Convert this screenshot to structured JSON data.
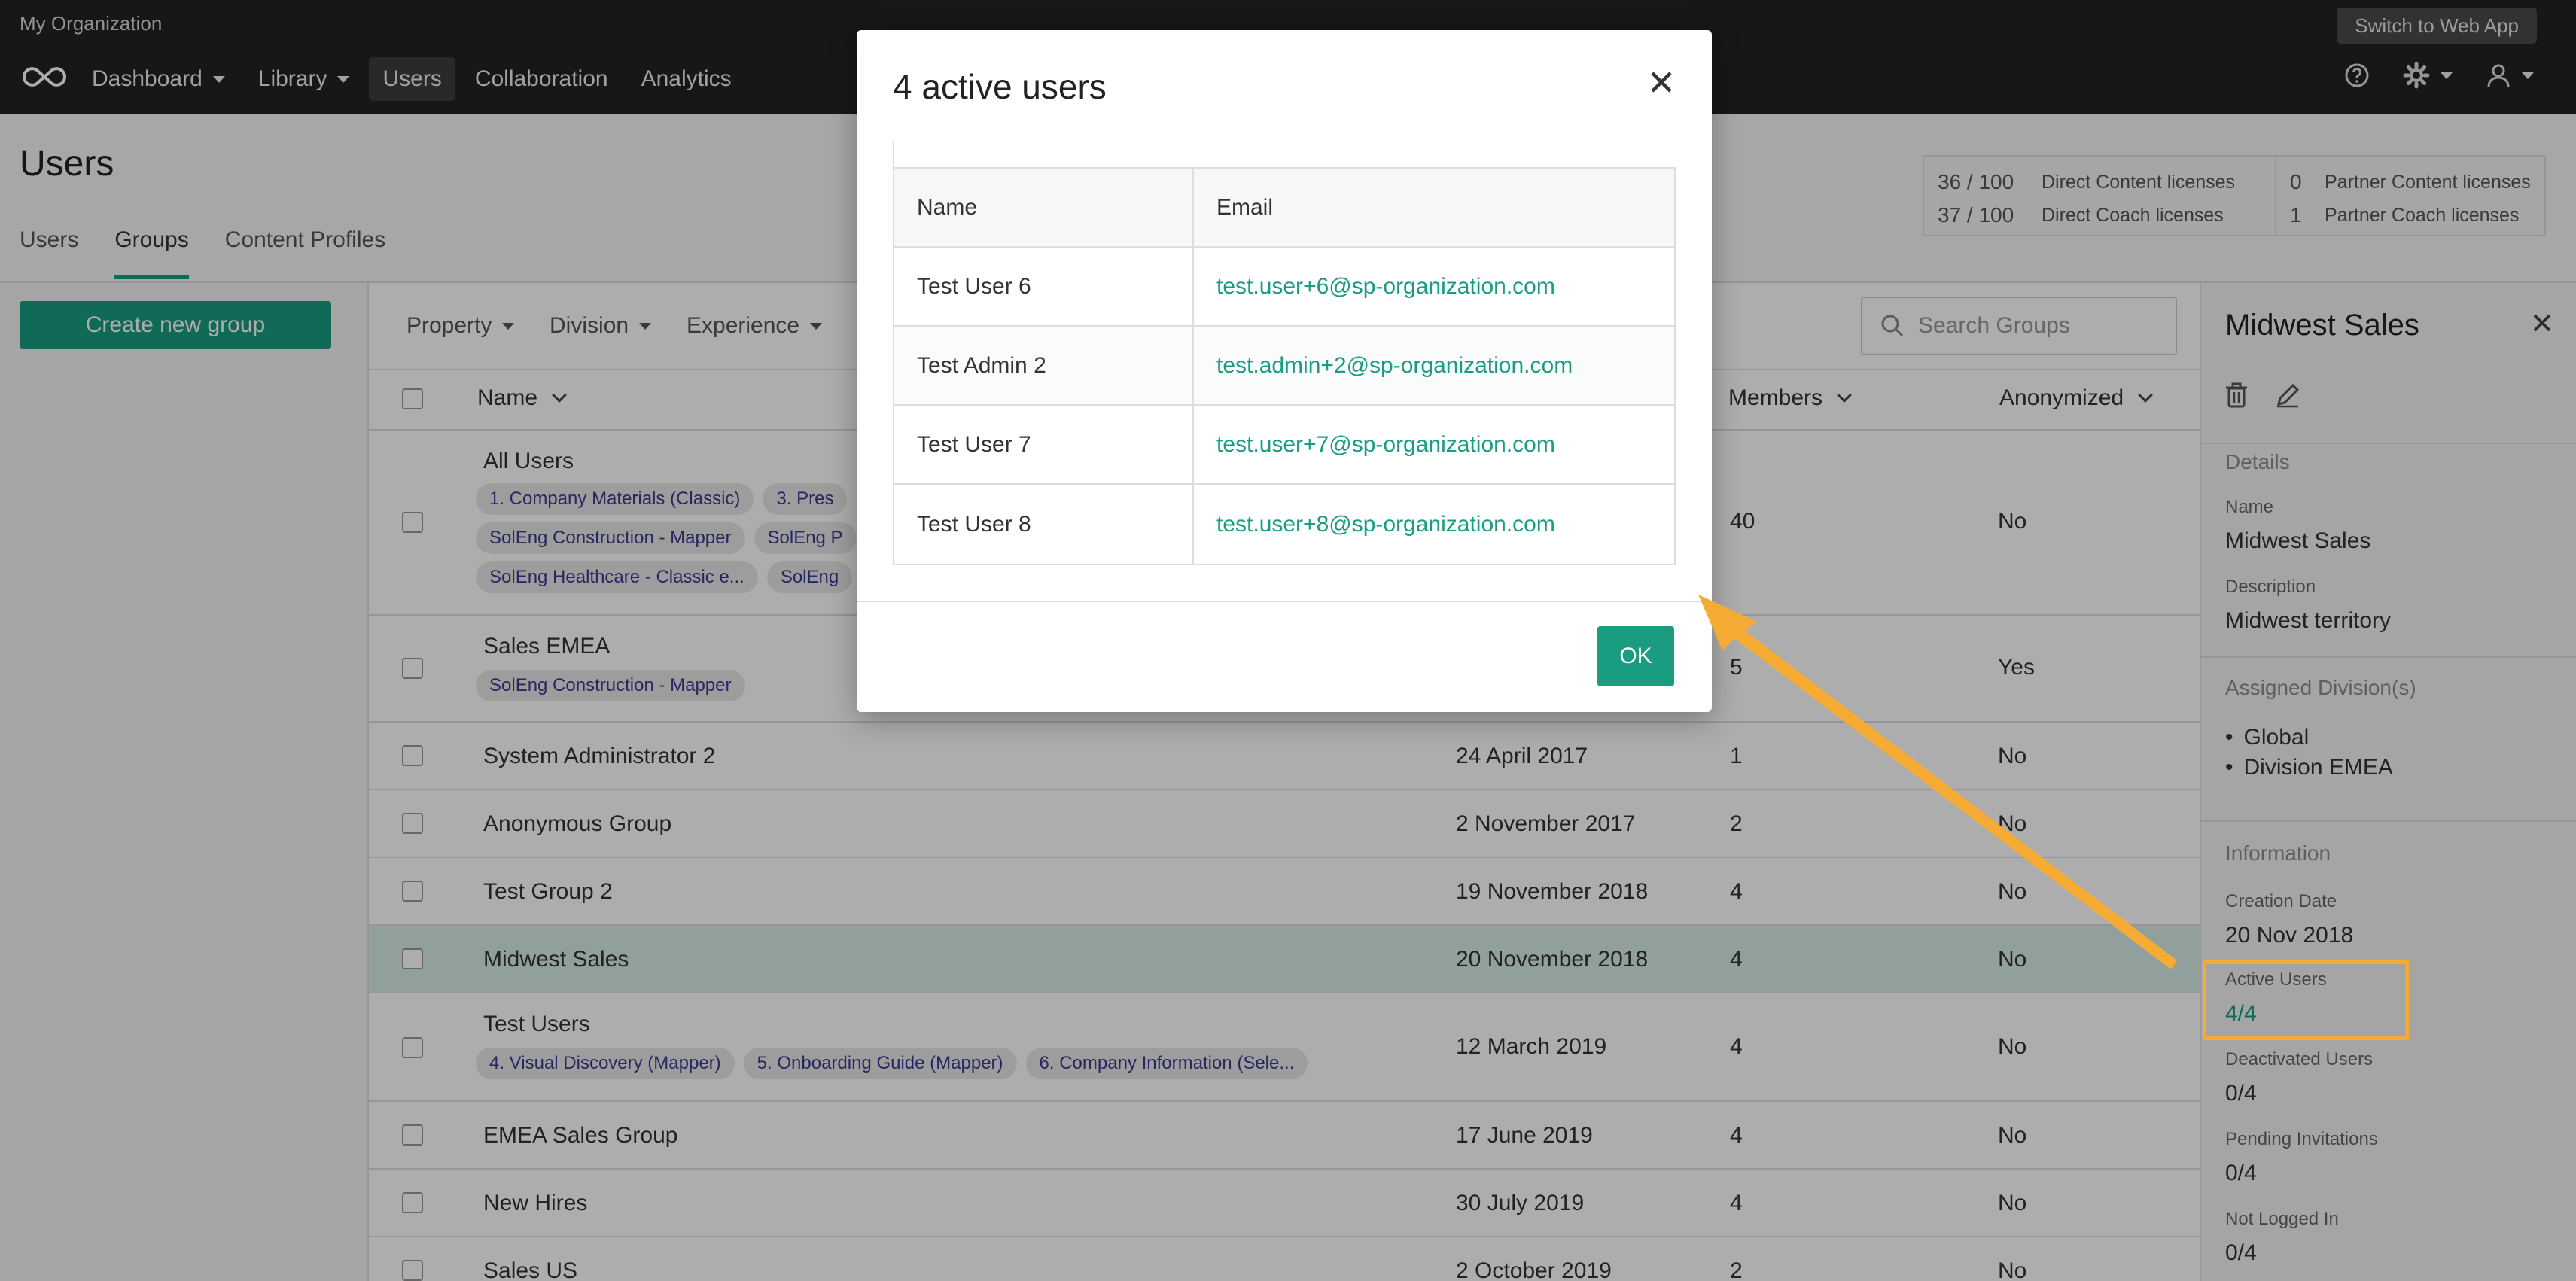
{
  "topbar": {
    "org_name": "My Organization",
    "switch_label": "Switch to Web App",
    "nav": [
      {
        "label": "Dashboard",
        "dropdown": true
      },
      {
        "label": "Library",
        "dropdown": true
      },
      {
        "label": "Users",
        "dropdown": false,
        "active": true
      },
      {
        "label": "Collaboration",
        "dropdown": false
      },
      {
        "label": "Analytics",
        "dropdown": false
      }
    ],
    "icons": [
      "help-icon",
      "gear-icon",
      "user-icon"
    ]
  },
  "page": {
    "title": "Users",
    "tabs": [
      "Users",
      "Groups",
      "Content Profiles"
    ],
    "active_tab": "Groups"
  },
  "licenses": {
    "direct": [
      {
        "count": "36 / 100",
        "label": "Direct Content licenses"
      },
      {
        "count": "37 / 100",
        "label": "Direct Coach licenses"
      }
    ],
    "partner": [
      {
        "count": "0",
        "label": "Partner Content licenses"
      },
      {
        "count": "1",
        "label": "Partner Coach licenses"
      }
    ]
  },
  "sidebar": {
    "create_label": "Create new group"
  },
  "filters": {
    "items": [
      "Property",
      "Division",
      "Experience"
    ],
    "search_placeholder": "Search Groups"
  },
  "table": {
    "headers": {
      "name": "Name",
      "members": "Members",
      "anonymized": "Anonymized"
    },
    "rows": [
      {
        "name": "All Users",
        "date": "",
        "members": "40",
        "anonymized": "No",
        "chips": [
          "1. Company Materials (Classic)",
          "3. Pres",
          "SolEng Construction - Mapper",
          "SolEng P",
          "SolEng Healthcare - Classic e...",
          "SolEng"
        ]
      },
      {
        "name": "Sales EMEA",
        "date": "",
        "members": "5",
        "anonymized": "Yes",
        "chips": [
          "SolEng Construction - Mapper"
        ]
      },
      {
        "name": "System Administrator 2",
        "date": "24 April 2017",
        "members": "1",
        "anonymized": "No",
        "chips": []
      },
      {
        "name": "Anonymous Group",
        "date": "2 November 2017",
        "members": "2",
        "anonymized": "No",
        "chips": []
      },
      {
        "name": "Test Group 2",
        "date": "19 November 2018",
        "members": "4",
        "anonymized": "No",
        "chips": []
      },
      {
        "name": "Midwest Sales",
        "date": "20 November 2018",
        "members": "4",
        "anonymized": "No",
        "chips": [],
        "selected": true
      },
      {
        "name": "Test Users",
        "date": "12 March 2019",
        "members": "4",
        "anonymized": "No",
        "chips": [
          "4. Visual Discovery (Mapper)",
          "5. Onboarding Guide (Mapper)",
          "6. Company Information (Sele..."
        ]
      },
      {
        "name": "EMEA Sales Group",
        "date": "17 June 2019",
        "members": "4",
        "anonymized": "No",
        "chips": []
      },
      {
        "name": "New Hires",
        "date": "30 July 2019",
        "members": "4",
        "anonymized": "No",
        "chips": []
      },
      {
        "name": "Sales US",
        "date": "2 October 2019",
        "members": "2",
        "anonymized": "No",
        "chips": []
      }
    ]
  },
  "detail": {
    "title": "Midwest Sales",
    "details_heading": "Details",
    "name_label": "Name",
    "name_value": "Midwest Sales",
    "description_label": "Description",
    "description_value": "Midwest territory",
    "divisions_heading": "Assigned Division(s)",
    "divisions": [
      "Global",
      "Division EMEA"
    ],
    "information_heading": "Information",
    "creation_label": "Creation Date",
    "creation_value": "20 Nov 2018",
    "active_label": "Active Users",
    "active_value": "4/4",
    "deactivated_label": "Deactivated Users",
    "deactivated_value": "0/4",
    "pending_label": "Pending Invitations",
    "pending_value": "0/4",
    "notlogged_label": "Not Logged In",
    "notlogged_value": "0/4"
  },
  "modal": {
    "title": "4 active users",
    "col_name": "Name",
    "col_email": "Email",
    "users": [
      {
        "name": "Test User 6",
        "email": "test.user+6@sp-organization.com"
      },
      {
        "name": "Test Admin 2",
        "email": "test.admin+2@sp-organization.com"
      },
      {
        "name": "Test User 7",
        "email": "test.user+7@sp-organization.com"
      },
      {
        "name": "Test User 8",
        "email": "test.user+8@sp-organization.com"
      }
    ],
    "ok_label": "OK"
  },
  "colors": {
    "accent": "#1a9c80",
    "annotation": "#f6ab35",
    "topbar": "#222222"
  }
}
